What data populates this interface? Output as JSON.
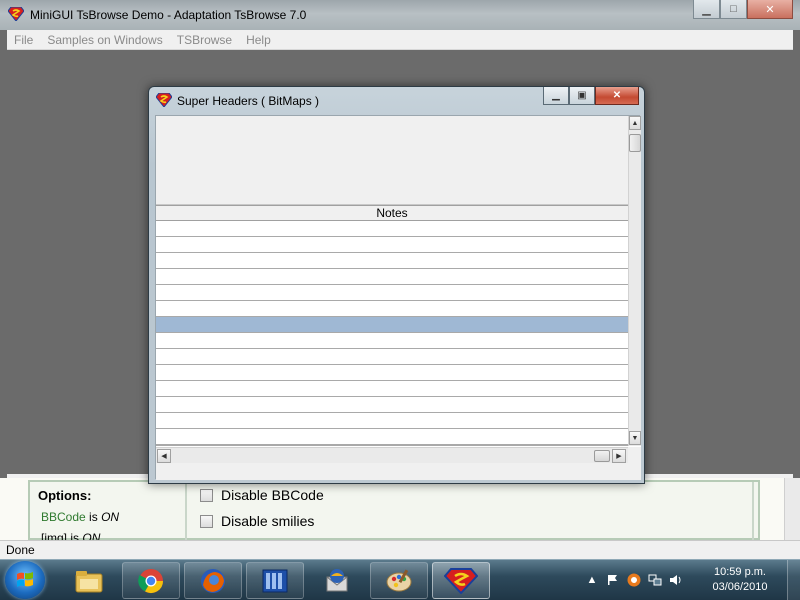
{
  "main_window": {
    "title": "MiniGUI TsBrowse Demo - Adaptation TsBrowse 7.0",
    "menu": [
      {
        "label": "File"
      },
      {
        "label": "Samples on Windows"
      },
      {
        "label": "TSBrowse"
      },
      {
        "label": "Help"
      }
    ]
  },
  "dialog": {
    "title": "Super Headers ( BitMaps )",
    "grid": {
      "column_header": "Notes",
      "row_count": 14,
      "selected_row_index": 6
    }
  },
  "background_page": {
    "options_title": "Options:",
    "bbcode_label": "BBCode",
    "bbcode_is": "is",
    "bbcode_state": "ON",
    "img_label": "[img]",
    "img_is": "is",
    "img_state": "ON",
    "disable_bbcode_label": "Disable BBCode",
    "disable_smilies_label": "Disable smilies"
  },
  "status_bar": {
    "text": "Done"
  },
  "taskbar": {
    "clock_time": "10:59 p.m.",
    "clock_date": "03/06/2010",
    "pinned": [
      {
        "icon": "folder-icon"
      },
      {
        "icon": "chrome-icon"
      },
      {
        "icon": "firefox-icon"
      },
      {
        "icon": "server-icon"
      },
      {
        "icon": "thunderbird-icon"
      },
      {
        "icon": "paint-icon"
      },
      {
        "icon": "superman-icon"
      }
    ]
  },
  "colors": {
    "selected_row": "#9fb8d4",
    "workspace": "#6b6b6b",
    "accent_red": "#c44a32"
  }
}
